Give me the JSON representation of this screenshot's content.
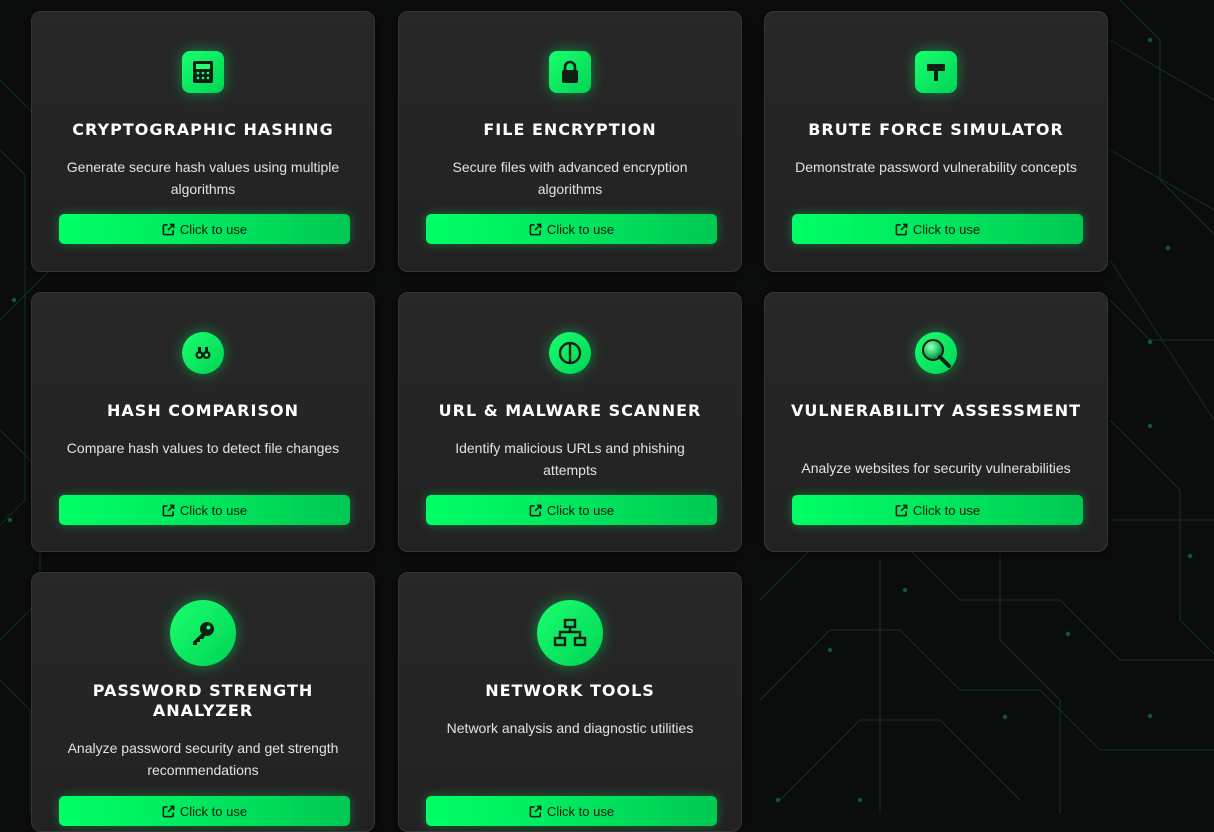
{
  "theme": {
    "accent": "#00ff66",
    "accent_dark": "#00c853",
    "card_bg": "#252525",
    "page_bg": "#0b0c0c"
  },
  "tools": [
    {
      "title": "CRYPTOGRAPHIC HASHING",
      "description": "Generate secure hash values using multiple algorithms",
      "icon": "calculator-icon",
      "button_label": "Click to use",
      "button_icon": "external-link-icon"
    },
    {
      "title": "FILE ENCRYPTION",
      "description": "Secure files with advanced encryption algorithms",
      "icon": "lock-icon",
      "button_label": "Click to use",
      "button_icon": "external-link-icon"
    },
    {
      "title": "BRUTE FORCE SIMULATOR",
      "description": "Demonstrate password vulnerability concepts",
      "icon": "hammer-icon",
      "button_label": "Click to use",
      "button_icon": "external-link-icon"
    },
    {
      "title": "HASH COMPARISON",
      "description": "Compare hash values to detect file changes",
      "icon": "compare-icon",
      "button_label": "Click to use",
      "button_icon": "external-link-icon"
    },
    {
      "title": "URL & MALWARE SCANNER",
      "description": "Identify malicious URLs and phishing attempts",
      "icon": "shield-icon",
      "button_label": "Click to use",
      "button_icon": "external-link-icon"
    },
    {
      "title": "VULNERABILITY ASSESSMENT",
      "description": "Analyze websites for security vulnerabilities",
      "icon": "magnifier-icon",
      "button_label": "Click to use",
      "button_icon": "external-link-icon"
    },
    {
      "title": "PASSWORD STRENGTH ANALYZER",
      "description": "Analyze password security and get strength recommendations",
      "icon": "key-icon",
      "button_label": "Click to use",
      "button_icon": "external-link-icon"
    },
    {
      "title": "NETWORK TOOLS",
      "description": "Network analysis and diagnostic utilities",
      "icon": "network-icon",
      "button_label": "Click to use",
      "button_icon": "external-link-icon"
    }
  ]
}
